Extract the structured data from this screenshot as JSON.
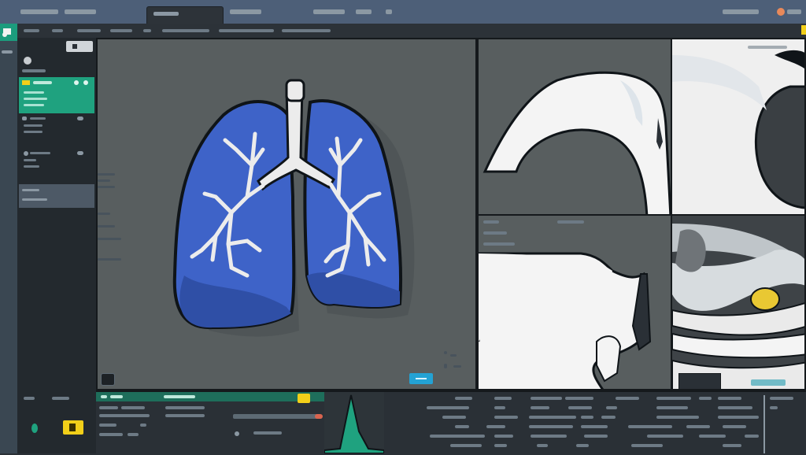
{
  "app": {
    "name": "",
    "window_tab": ""
  },
  "menu": [],
  "sidebar": {
    "items": []
  },
  "viewport": {
    "main_view": "3D lung render",
    "panels": [
      "axial-slice-top",
      "coronal-slice-top-right",
      "sagittal-slice-bottom",
      "oblique-slice-bottom-right"
    ]
  },
  "icons": {
    "lung": "lungs-3d-model",
    "trachea": "airway-tree",
    "window_close": "close-icon",
    "status_dot": "status-dot-icon"
  },
  "colors": {
    "titlebar": "#4d5f78",
    "accent": "#1fa27f",
    "lung": "#3e63c8",
    "highlight": "#f2cf19",
    "info": "#23a2d4",
    "status_orange": "#e8895a"
  },
  "histogram": {
    "shape": "triangle-peak"
  }
}
